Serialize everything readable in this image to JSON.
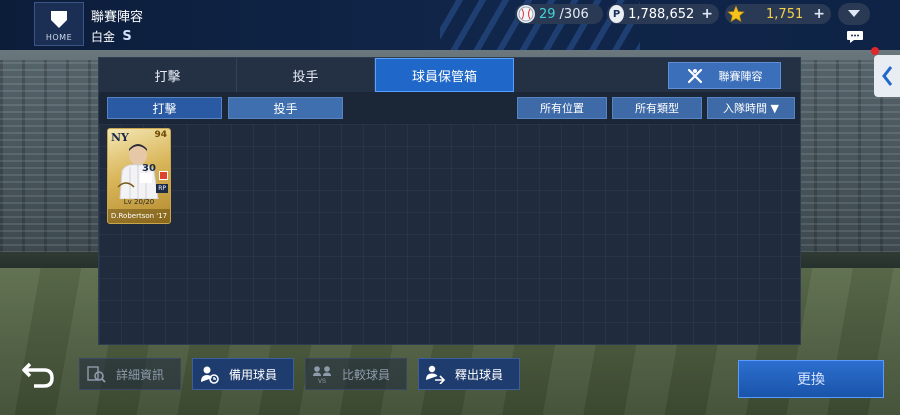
{
  "header": {
    "home_label": "HOME",
    "page_title": "聯賽陣容",
    "rank_label": "白金",
    "rank_badge": "S",
    "balls_current": "29",
    "balls_total": "/306",
    "points": "1,788,652",
    "stars": "1,751",
    "points_icon_letter": "P"
  },
  "tabs": {
    "batting": "打擊",
    "pitching": "投手",
    "storage": "球員保管箱",
    "lineup_button": "聯賽陣容"
  },
  "filters": {
    "batting": "打擊",
    "pitching": "投手",
    "position": "所有位置",
    "type": "所有類型",
    "join_time": "入隊時間 ▼"
  },
  "cards": [
    {
      "team_logo": "NY",
      "overall": "94",
      "jersey_number": "30",
      "position": "RP",
      "level": "Lv 20/20",
      "name": "D.Robertson '17"
    }
  ],
  "actions": {
    "details": "詳細資訊",
    "reserve": "備用球員",
    "compare": "比較球員",
    "release": "釋出球員",
    "swap": "更換"
  },
  "colors": {
    "accent": "#1f67c9",
    "card_gold": "#d9b65a",
    "topbar": "#0c1d3a"
  }
}
